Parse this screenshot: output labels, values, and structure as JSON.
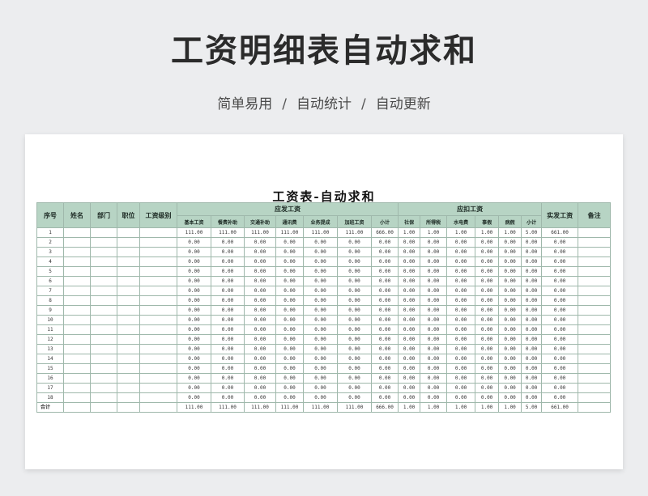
{
  "banner": {
    "title": "工资明细表自动求和",
    "tags": [
      "简单易用",
      "自动统计",
      "自动更新"
    ],
    "separator": "/"
  },
  "sheet": {
    "title": "工资表-自动求和",
    "headers": {
      "seq": "序号",
      "name": "姓名",
      "dept": "部门",
      "position": "职位",
      "grade": "工资级别",
      "payable_group": "应发工资",
      "payable_cols": [
        "基本工资",
        "餐费补助",
        "交通补助",
        "通讯费",
        "业务提成",
        "加班工资",
        "小计"
      ],
      "deduct_group": "应扣工资",
      "deduct_cols": [
        "社保",
        "所得税",
        "水电费",
        "事假",
        "病假",
        "小计"
      ],
      "net": "实发工资",
      "remark": "备注"
    },
    "rows": [
      {
        "seq": "1",
        "payable": [
          "111.00",
          "111.00",
          "111.00",
          "111.00",
          "111.00",
          "111.00",
          "666.00"
        ],
        "deduct": [
          "1.00",
          "1.00",
          "1.00",
          "1.00",
          "1.00",
          "5.00"
        ],
        "net": "661.00"
      },
      {
        "seq": "2",
        "payable": [
          "0.00",
          "0.00",
          "0.00",
          "0.00",
          "0.00",
          "0.00",
          "0.00"
        ],
        "deduct": [
          "0.00",
          "0.00",
          "0.00",
          "0.00",
          "0.00",
          "0.00"
        ],
        "net": "0.00"
      },
      {
        "seq": "3",
        "payable": [
          "0.00",
          "0.00",
          "0.00",
          "0.00",
          "0.00",
          "0.00",
          "0.00"
        ],
        "deduct": [
          "0.00",
          "0.00",
          "0.00",
          "0.00",
          "0.00",
          "0.00"
        ],
        "net": "0.00"
      },
      {
        "seq": "4",
        "payable": [
          "0.00",
          "0.00",
          "0.00",
          "0.00",
          "0.00",
          "0.00",
          "0.00"
        ],
        "deduct": [
          "0.00",
          "0.00",
          "0.00",
          "0.00",
          "0.00",
          "0.00"
        ],
        "net": "0.00"
      },
      {
        "seq": "5",
        "payable": [
          "0.00",
          "0.00",
          "0.00",
          "0.00",
          "0.00",
          "0.00",
          "0.00"
        ],
        "deduct": [
          "0.00",
          "0.00",
          "0.00",
          "0.00",
          "0.00",
          "0.00"
        ],
        "net": "0.00"
      },
      {
        "seq": "6",
        "payable": [
          "0.00",
          "0.00",
          "0.00",
          "0.00",
          "0.00",
          "0.00",
          "0.00"
        ],
        "deduct": [
          "0.00",
          "0.00",
          "0.00",
          "0.00",
          "0.00",
          "0.00"
        ],
        "net": "0.00"
      },
      {
        "seq": "7",
        "payable": [
          "0.00",
          "0.00",
          "0.00",
          "0.00",
          "0.00",
          "0.00",
          "0.00"
        ],
        "deduct": [
          "0.00",
          "0.00",
          "0.00",
          "0.00",
          "0.00",
          "0.00"
        ],
        "net": "0.00"
      },
      {
        "seq": "8",
        "payable": [
          "0.00",
          "0.00",
          "0.00",
          "0.00",
          "0.00",
          "0.00",
          "0.00"
        ],
        "deduct": [
          "0.00",
          "0.00",
          "0.00",
          "0.00",
          "0.00",
          "0.00"
        ],
        "net": "0.00"
      },
      {
        "seq": "9",
        "payable": [
          "0.00",
          "0.00",
          "0.00",
          "0.00",
          "0.00",
          "0.00",
          "0.00"
        ],
        "deduct": [
          "0.00",
          "0.00",
          "0.00",
          "0.00",
          "0.00",
          "0.00"
        ],
        "net": "0.00"
      },
      {
        "seq": "10",
        "payable": [
          "0.00",
          "0.00",
          "0.00",
          "0.00",
          "0.00",
          "0.00",
          "0.00"
        ],
        "deduct": [
          "0.00",
          "0.00",
          "0.00",
          "0.00",
          "0.00",
          "0.00"
        ],
        "net": "0.00"
      },
      {
        "seq": "11",
        "payable": [
          "0.00",
          "0.00",
          "0.00",
          "0.00",
          "0.00",
          "0.00",
          "0.00"
        ],
        "deduct": [
          "0.00",
          "0.00",
          "0.00",
          "0.00",
          "0.00",
          "0.00"
        ],
        "net": "0.00"
      },
      {
        "seq": "12",
        "payable": [
          "0.00",
          "0.00",
          "0.00",
          "0.00",
          "0.00",
          "0.00",
          "0.00"
        ],
        "deduct": [
          "0.00",
          "0.00",
          "0.00",
          "0.00",
          "0.00",
          "0.00"
        ],
        "net": "0.00"
      },
      {
        "seq": "13",
        "payable": [
          "0.00",
          "0.00",
          "0.00",
          "0.00",
          "0.00",
          "0.00",
          "0.00"
        ],
        "deduct": [
          "0.00",
          "0.00",
          "0.00",
          "0.00",
          "0.00",
          "0.00"
        ],
        "net": "0.00"
      },
      {
        "seq": "14",
        "payable": [
          "0.00",
          "0.00",
          "0.00",
          "0.00",
          "0.00",
          "0.00",
          "0.00"
        ],
        "deduct": [
          "0.00",
          "0.00",
          "0.00",
          "0.00",
          "0.00",
          "0.00"
        ],
        "net": "0.00"
      },
      {
        "seq": "15",
        "payable": [
          "0.00",
          "0.00",
          "0.00",
          "0.00",
          "0.00",
          "0.00",
          "0.00"
        ],
        "deduct": [
          "0.00",
          "0.00",
          "0.00",
          "0.00",
          "0.00",
          "0.00"
        ],
        "net": "0.00"
      },
      {
        "seq": "16",
        "payable": [
          "0.00",
          "0.00",
          "0.00",
          "0.00",
          "0.00",
          "0.00",
          "0.00"
        ],
        "deduct": [
          "0.00",
          "0.00",
          "0.00",
          "0.00",
          "0.00",
          "0.00"
        ],
        "net": "0.00"
      },
      {
        "seq": "17",
        "payable": [
          "0.00",
          "0.00",
          "0.00",
          "0.00",
          "0.00",
          "0.00",
          "0.00"
        ],
        "deduct": [
          "0.00",
          "0.00",
          "0.00",
          "0.00",
          "0.00",
          "0.00"
        ],
        "net": "0.00"
      },
      {
        "seq": "18",
        "payable": [
          "0.00",
          "0.00",
          "0.00",
          "0.00",
          "0.00",
          "0.00",
          "0.00"
        ],
        "deduct": [
          "0.00",
          "0.00",
          "0.00",
          "0.00",
          "0.00",
          "0.00"
        ],
        "net": "0.00"
      }
    ],
    "total": {
      "label": "合计",
      "payable": [
        "111.00",
        "111.00",
        "111.00",
        "111.00",
        "111.00",
        "111.00",
        "666.00"
      ],
      "deduct": [
        "1.00",
        "1.00",
        "1.00",
        "1.00",
        "1.00",
        "5.00"
      ],
      "net": "661.00"
    }
  }
}
